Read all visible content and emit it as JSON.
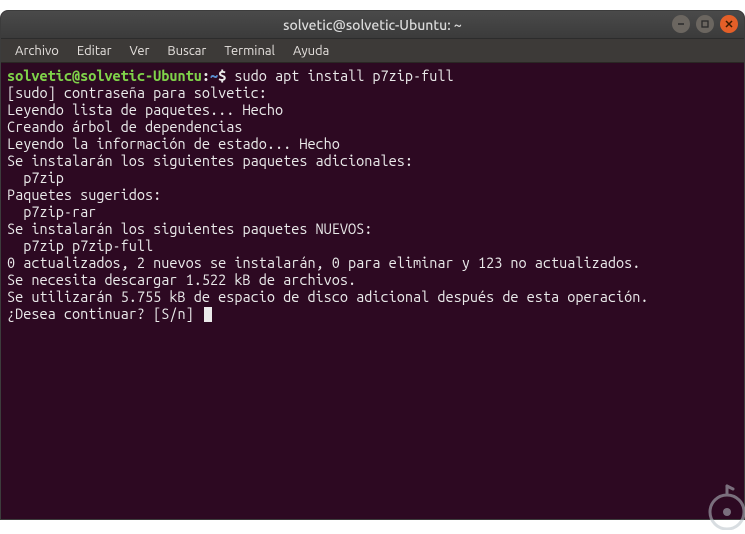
{
  "window": {
    "title": "solvetic@solvetic-Ubuntu: ~"
  },
  "menu": {
    "items": [
      "Archivo",
      "Editar",
      "Ver",
      "Buscar",
      "Terminal",
      "Ayuda"
    ]
  },
  "prompt": {
    "user_host": "solvetic@solvetic-Ubuntu",
    "sep": ":",
    "path": "~",
    "dollar": "$",
    "command": "sudo apt install p7zip-full"
  },
  "output": [
    "[sudo] contraseña para solvetic: ",
    "Leyendo lista de paquetes... Hecho",
    "Creando árbol de dependencias       ",
    "Leyendo la información de estado... Hecho",
    "Se instalarán los siguientes paquetes adicionales:",
    "  p7zip",
    "Paquetes sugeridos:",
    "  p7zip-rar",
    "Se instalarán los siguientes paquetes NUEVOS:",
    "  p7zip p7zip-full",
    "0 actualizados, 2 nuevos se instalarán, 0 para eliminar y 123 no actualizados.",
    "Se necesita descargar 1.522 kB de archivos.",
    "Se utilizarán 5.755 kB de espacio de disco adicional después de esta operación.",
    "¿Desea continuar? [S/n] "
  ],
  "controls": {
    "minimize": "−",
    "maximize": "□",
    "close": "×"
  }
}
